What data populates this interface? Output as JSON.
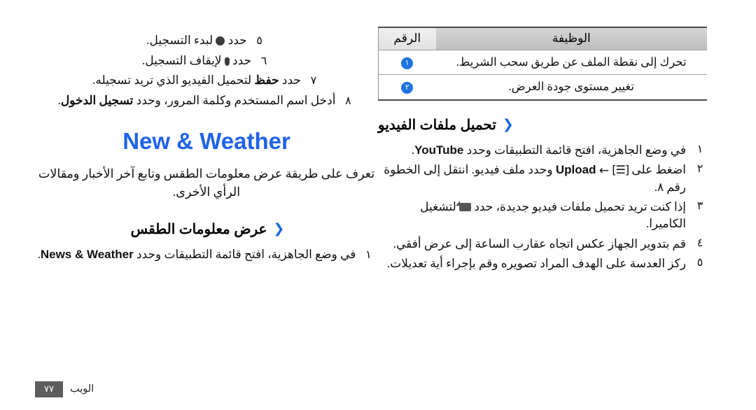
{
  "page": {
    "footer_label": "الويب",
    "page_number": "٧٧"
  },
  "table": {
    "name": "video-player-functions-table",
    "headers": {
      "number": "الرقم",
      "function": "الوظيفة"
    },
    "rows": [
      {
        "badge": "١",
        "function": "تحرك إلى نقطة الملف عن طريق سحب الشريط."
      },
      {
        "badge": "٢",
        "function": "تغيير مستوى جودة العرض."
      }
    ]
  },
  "upload_section": {
    "heading": "تحميل ملفات الفيديو",
    "chevron": "❮",
    "steps": [
      {
        "num": "١",
        "parts": [
          {
            "type": "ar",
            "text": "في وضع الجاهزية، افتح قائمة التطبيقات وحدد "
          },
          {
            "type": "lat",
            "text": "YouTube"
          },
          {
            "type": "ar",
            "text": "."
          }
        ]
      },
      {
        "num": "٢",
        "parts": [
          {
            "type": "ar",
            "text": "اضغط على "
          },
          {
            "type": "icon",
            "icon": "menu-key-icon",
            "glyph": "[☰]"
          },
          {
            "type": "icon",
            "icon": "arrow-left-icon",
            "glyph": "←"
          },
          {
            "type": "lat",
            "text": "Upload"
          },
          {
            "type": "ar",
            "text": " وحدد ملف فيديو. انتقل إلى الخطوة رقم ٨."
          }
        ]
      },
      {
        "num": "٣",
        "parts": [
          {
            "type": "ar",
            "text": "إذا كنت تريد تحميل ملفات فيديو جديدة، حدد "
          },
          {
            "type": "icon",
            "icon": "video-camera-icon",
            "glyph": ""
          },
          {
            "type": "ar",
            "text": " لتشغيل الكاميرا."
          }
        ]
      },
      {
        "num": "٤",
        "parts": [
          {
            "type": "ar",
            "text": "قم بتدوير الجهاز عكس اتجاه عقارب الساعة إلى عرض أفقي."
          }
        ]
      },
      {
        "num": "٥",
        "parts": [
          {
            "type": "ar",
            "text": "ركز العدسة على الهدف المراد تصويره وقم بإجراء أية تعديلات."
          }
        ]
      }
    ]
  },
  "left_column": {
    "continued_steps": [
      {
        "num": "٥",
        "parts": [
          {
            "type": "ar",
            "text": "حدد "
          },
          {
            "type": "icon",
            "icon": "record-circle-icon",
            "glyph": ""
          },
          {
            "type": "ar",
            "text": " لبدء التسجيل."
          }
        ]
      },
      {
        "num": "٦",
        "parts": [
          {
            "type": "ar",
            "text": "حدد "
          },
          {
            "type": "icon",
            "icon": "stop-recording-icon",
            "glyph": ""
          },
          {
            "type": "ar",
            "text": " لإيقاف التسجيل."
          }
        ]
      },
      {
        "num": "٧",
        "parts": [
          {
            "type": "ar",
            "text": "حدد "
          },
          {
            "type": "bold",
            "text": "حفظ"
          },
          {
            "type": "ar",
            "text": " لتحميل الفيديو الذي تريد تسجيله."
          }
        ]
      },
      {
        "num": "٨",
        "parts": [
          {
            "type": "ar",
            "text": "أدخل اسم المستخدم وكلمة المرور، وحدد "
          },
          {
            "type": "bold",
            "text": "تسجيل الدخول"
          },
          {
            "type": "ar",
            "text": "."
          }
        ]
      }
    ],
    "chapter_title": "New & Weather",
    "chapter_intro": "تعرف على طريقة عرض معلومات الطقس وتابع آخر الأخبار ومقالات الرأي الأخرى.",
    "weather_section": {
      "heading": "عرض معلومات الطقس",
      "chevron": "❮",
      "steps": [
        {
          "num": "١",
          "parts": [
            {
              "type": "ar",
              "text": "في وضع الجاهزية، افتح قائمة التطبيقات وحدد "
            },
            {
              "type": "lat",
              "text": "News & Weather"
            },
            {
              "type": "ar",
              "text": "."
            }
          ]
        }
      ]
    }
  },
  "colors": {
    "accent_blue": "#1f63e8",
    "badge_blue": "#1f74e0",
    "chevron_blue": "#1466dc",
    "table_header_gray": "#c6c6c6",
    "footer_gray": "#5d5d5d"
  }
}
